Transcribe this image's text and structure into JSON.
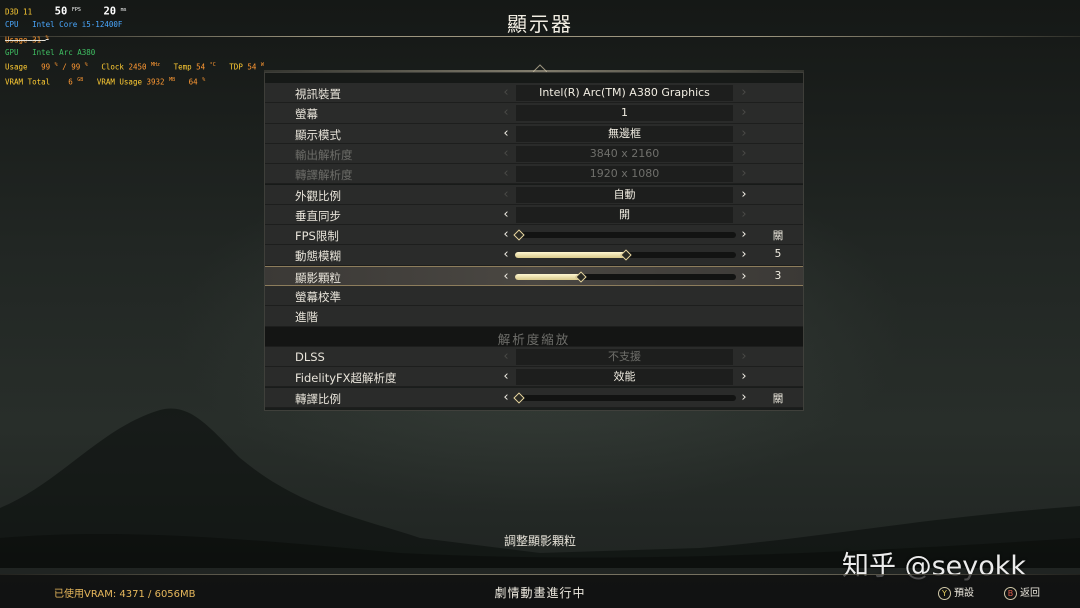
{
  "screen": {
    "title": "顯示器"
  },
  "hud": {
    "api": "D3D 11",
    "fps": "50",
    "fps_unit": "FPS",
    "frametime": "20",
    "frametime_unit": "ms",
    "cpu_label": "CPU",
    "cpu_name": "Intel Core i5-12400F",
    "cpu_usage_label": "Usage",
    "cpu_usage": "31",
    "cpu_usage_unit": "%",
    "gpu_label": "GPU",
    "gpu_name": "Intel Arc A380",
    "gpu_usage_label": "Usage",
    "gpu_usage": "99",
    "gpu_usage_unit": "%",
    "gpu_usage2": "99",
    "gpu_usage2_unit": "%",
    "clock_label": "Clock",
    "clock": "2450",
    "clock_unit": "MHz",
    "temp_label": "Temp",
    "temp": "54",
    "temp_unit": "°C",
    "tdp_label": "TDP",
    "tdp": "54",
    "tdp_unit": "W",
    "vram_total_label": "VRAM Total",
    "vram_total": "6",
    "vram_total_unit": "GB",
    "vram_usage_label": "VRAM Usage",
    "vram_usage": "3932",
    "vram_usage_unit": "MB",
    "vram_percent": "64",
    "vram_percent_unit": "%",
    "colors": {
      "yellow": "#ffcc33",
      "orange": "#ff9933",
      "blue": "#4aa8ff",
      "green": "#3fbf62"
    }
  },
  "settings": {
    "rows": [
      {
        "label": "視訊裝置",
        "value": "Intel(R) Arc(TM) A380 Graphics",
        "left_arrow": "‹",
        "right_arrow": "›"
      },
      {
        "label": "螢幕",
        "value": "1",
        "left_arrow": "‹",
        "right_arrow": "›"
      },
      {
        "label": "顯示模式",
        "value": "無邊框",
        "left_arrow": "‹",
        "right_arrow": "›"
      },
      {
        "label": "輸出解析度",
        "value": "3840 x 2160",
        "left_arrow": "‹",
        "right_arrow": "›"
      },
      {
        "label": "轉譯解析度",
        "value": "1920 x 1080",
        "left_arrow": "‹",
        "right_arrow": "›"
      },
      {
        "label": "外觀比例",
        "value": "自動",
        "left_arrow": "‹",
        "right_arrow": "›"
      },
      {
        "label": "垂直同步",
        "value": "開",
        "left_arrow": "‹",
        "right_arrow": "›"
      },
      {
        "label": "FPS限制",
        "side_value": "關",
        "slider_fraction": 0.0,
        "left_arrow": "‹",
        "right_arrow": "›"
      },
      {
        "label": "動態模糊",
        "side_value": "5",
        "slider_fraction": 0.5,
        "left_arrow": "‹",
        "right_arrow": "›"
      },
      {
        "label": "顯影顆粒",
        "side_value": "3",
        "slider_fraction": 0.3,
        "left_arrow": "‹",
        "right_arrow": "›"
      },
      {
        "label": "螢幕校準"
      },
      {
        "label": "進階"
      },
      {
        "section": "解析度縮放"
      },
      {
        "label": "DLSS",
        "value": "不支援",
        "left_arrow": "‹",
        "right_arrow": "›"
      },
      {
        "label": "FidelityFX超解析度",
        "value": "效能",
        "left_arrow": "‹",
        "right_arrow": "›"
      },
      {
        "label": "轉譯比例",
        "side_value": "關",
        "slider_fraction": 0.0,
        "left_arrow": "‹",
        "right_arrow": "›"
      }
    ]
  },
  "description": "調整顯影顆粒",
  "footer": {
    "vram_label": "已使用VRAM: 4371 / 6056MB",
    "status": "劇情動畫進行中",
    "hint_default_button": "Y",
    "hint_default": "預設",
    "hint_back_button": "B",
    "hint_back": "返回"
  },
  "watermark": "知乎 @seyokk",
  "colors": {
    "accent_gold": "#e8d7a0",
    "vram_text": "#e7b85c"
  }
}
